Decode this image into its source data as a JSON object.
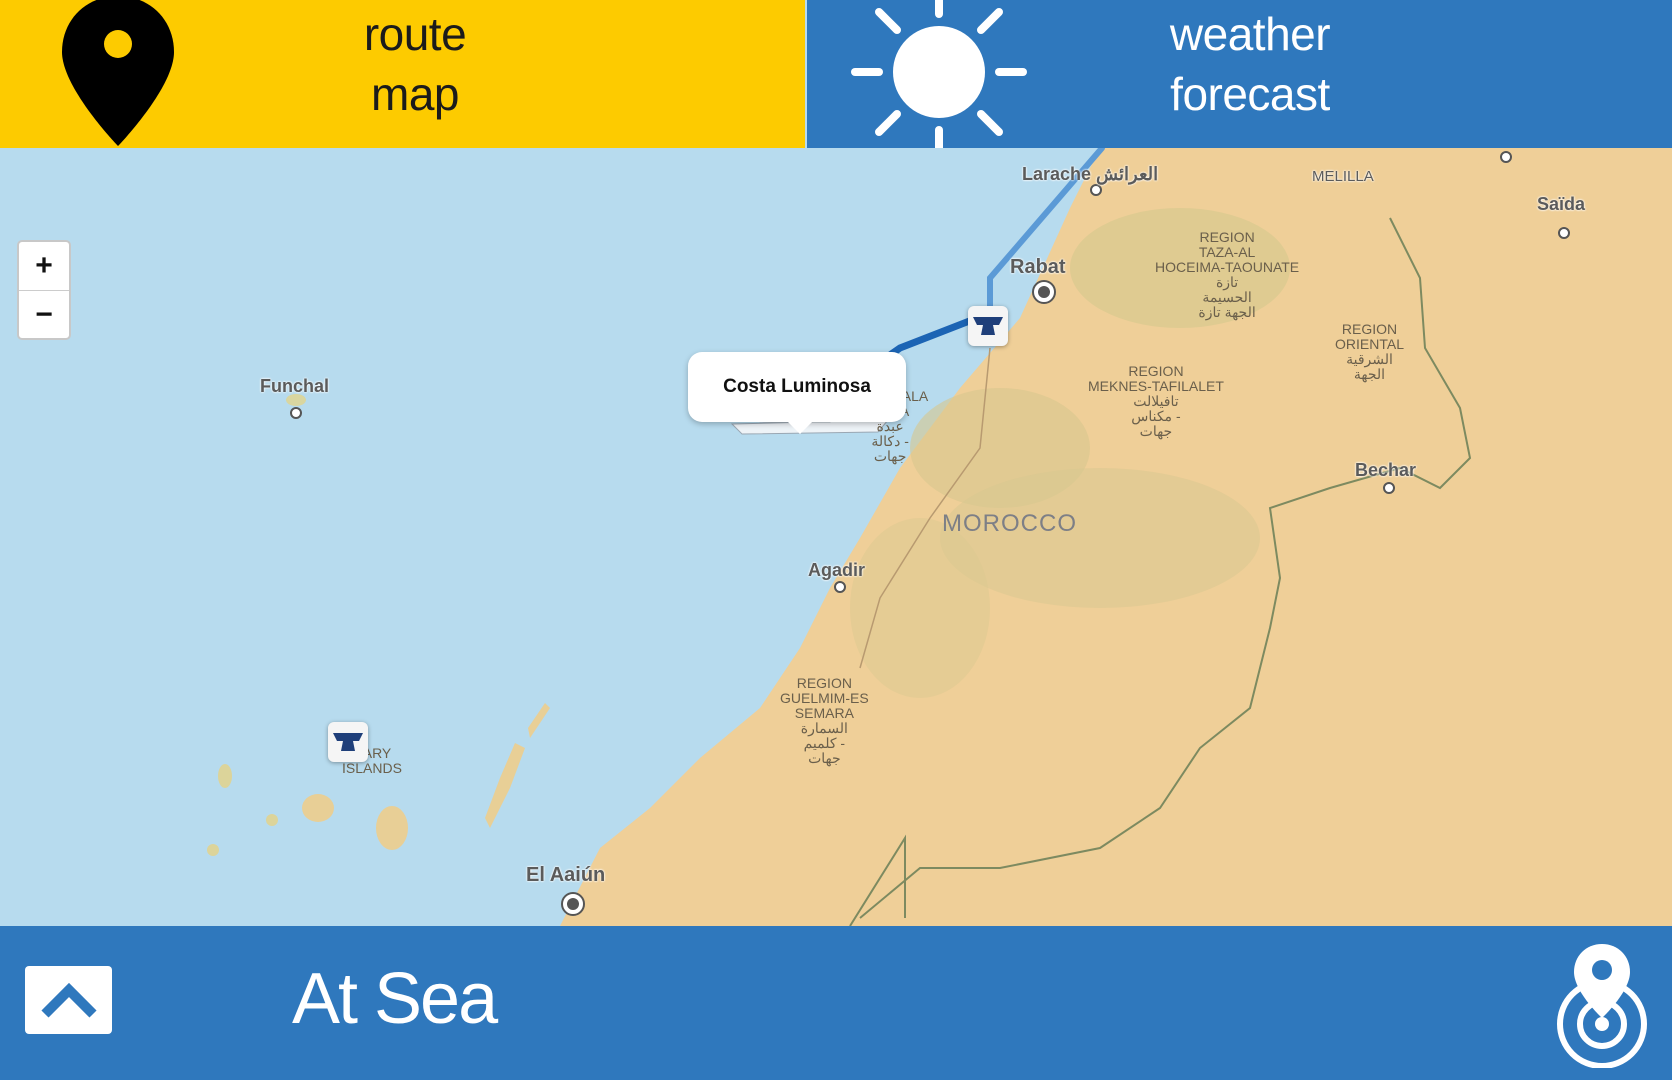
{
  "tabs": {
    "route": {
      "line1": "route",
      "line2": "map",
      "color": "#fdcb00",
      "icon": "map-pin-icon"
    },
    "weather": {
      "line1": "weather",
      "line2": "forecast",
      "color": "#2f78bd",
      "icon": "sun-icon"
    }
  },
  "map": {
    "zoom_in": "+",
    "zoom_out": "−",
    "popup": "Costa Luminosa",
    "cities": {
      "larache": "Larache العرائش",
      "melilla": "MELILLA",
      "saida": "Saïda",
      "rabat": "Rabat",
      "funchal": "Funchal",
      "agadir": "Agadir",
      "bechar": "Bechar",
      "el_aaiun": "El Aaiún"
    },
    "regions": {
      "taza": "REGION\nTAZA-AL\nHOCEIMA-TAOUNATE\nتازة\nالحسيمة\nالجهة تازة",
      "oriental": "REGION\nORIENTAL\nالشرقية\nالجهة",
      "meknes": "REGION\nMEKNES-TAFILALET\nتافيلالت\nمكناس -\nجهات",
      "doukkala": "ON\nDOUKKALA\nABDA\nعبدة\nدكالة -\nجهات",
      "guelmim": "REGION\nGUELMIM-ES\nSEMARA\nالسمارة\nكلميم -\nجهات",
      "canary": "NARY\nISLANDS"
    },
    "country": "MOROCCO"
  },
  "bottom": {
    "status": "At Sea",
    "up_icon": "chevron-up-icon",
    "locate_icon": "locate-icon",
    "color": "#2f78bd"
  }
}
